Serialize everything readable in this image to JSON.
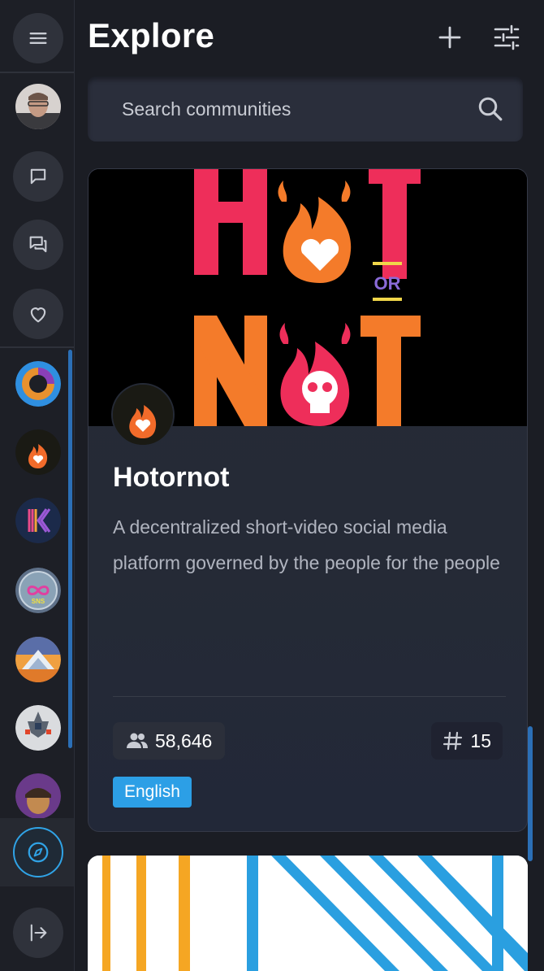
{
  "header": {
    "title": "Explore",
    "add_icon": "plus-icon",
    "filter_icon": "sliders-icon"
  },
  "search": {
    "placeholder": "Search communities",
    "icon": "search-icon"
  },
  "rail": {
    "menu_icon": "hamburger-icon",
    "nav_icons": [
      "chat-bubble-icon",
      "chats-icon",
      "heart-icon"
    ],
    "communities": [
      "community-ring",
      "community-hotornot",
      "community-k",
      "community-sns",
      "community-mountain",
      "community-spaceship",
      "community-portrait"
    ],
    "explore_icon": "compass-icon",
    "logout_icon": "exit-arrow-icon",
    "accent_color": "#30a3e6"
  },
  "card": {
    "name": "Hotornot",
    "description": "A decentralized short-video social media platform governed by the people for the people",
    "members": "58,646",
    "channels": "15",
    "language": "English",
    "banner_text": [
      "H",
      "T",
      "OR",
      "N",
      "T"
    ]
  }
}
